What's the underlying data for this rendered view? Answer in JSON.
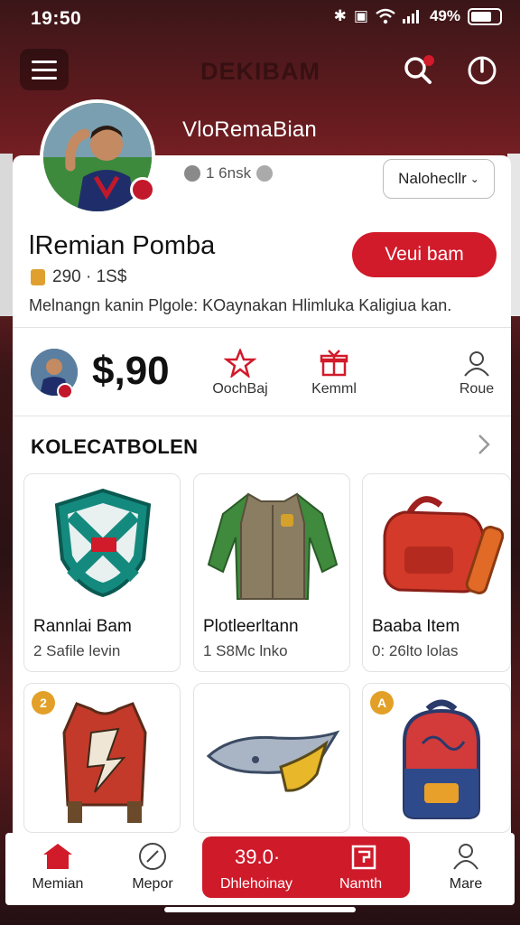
{
  "status_bar": {
    "time": "19:50",
    "battery": "49%"
  },
  "header": {
    "ghost_title": "DEKIBAM"
  },
  "profile": {
    "username": "VloRemaBian",
    "stat": "1 6nsk",
    "select_label": "Nalohecllr",
    "name": "lRemian Pomba",
    "sub_stats": "290 · 1S$",
    "primary_button": "Veui bam",
    "description": "Melnangn kanin Plgole: KOaynakan Hlimluka Kaligiua kan."
  },
  "balance": {
    "amount": "$,90",
    "actions": [
      {
        "label": "OochBaj",
        "icon": "star-icon"
      },
      {
        "label": "Kemml",
        "icon": "gift-icon"
      },
      {
        "label": "Roue",
        "icon": "profile-icon"
      }
    ]
  },
  "collection": {
    "title": "KOLECATBOLEN",
    "items": [
      {
        "name": "Rannlai Bam",
        "meta": "2 Safile levin",
        "icon": "shield-icon"
      },
      {
        "name": "Plotleerltann",
        "meta": "1 S8Mc lnko",
        "icon": "jacket-icon"
      },
      {
        "name": "Baaba Item",
        "meta": "0: 26lto lolas",
        "icon": "bag-icon"
      },
      {
        "name": "",
        "meta": "",
        "badge": "2",
        "icon": "vest-icon"
      },
      {
        "name": "",
        "meta": "",
        "icon": "hat-icon"
      },
      {
        "name": "",
        "meta": "",
        "badge": "A",
        "icon": "backpack-icon"
      }
    ]
  },
  "bottom_nav": {
    "items": [
      {
        "label": "Memian",
        "icon": "home-icon"
      },
      {
        "label": "Mepor",
        "icon": "compass-icon"
      },
      {
        "label": "Mare",
        "icon": "user-icon"
      }
    ],
    "center": {
      "amount": "39.0·",
      "label_left": "Dhlehoinay",
      "label_right": "Namth"
    }
  },
  "colors": {
    "accent": "#d11a2a",
    "background": "#3a1618"
  }
}
